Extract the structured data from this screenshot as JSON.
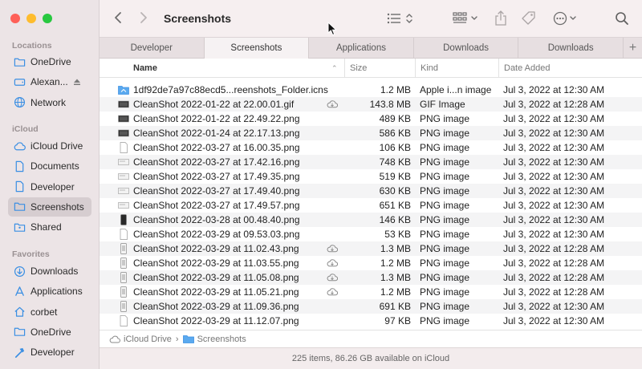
{
  "window": {
    "title": "Screenshots"
  },
  "sidebar": {
    "sections": {
      "locations": "Locations",
      "icloud": "iCloud",
      "favorites": "Favorites"
    },
    "locations": [
      {
        "label": "OneDrive",
        "icon": "folder-icon"
      },
      {
        "label": "Alexan...",
        "icon": "drive-icon"
      },
      {
        "label": "Network",
        "icon": "network-icon"
      }
    ],
    "icloud": [
      {
        "label": "iCloud Drive",
        "icon": "cloud-icon"
      },
      {
        "label": "Documents",
        "icon": "document-icon"
      },
      {
        "label": "Developer",
        "icon": "document-icon"
      },
      {
        "label": "Screenshots",
        "icon": "folder-icon",
        "active": true
      },
      {
        "label": "Shared",
        "icon": "shared-folder-icon"
      }
    ],
    "favorites": [
      {
        "label": "Downloads",
        "icon": "download-icon"
      },
      {
        "label": "Applications",
        "icon": "applications-icon"
      },
      {
        "label": "corbet",
        "icon": "home-icon"
      },
      {
        "label": "OneDrive",
        "icon": "folder-icon"
      },
      {
        "label": "Developer",
        "icon": "hammer-icon"
      }
    ]
  },
  "tabs": [
    {
      "label": "Developer"
    },
    {
      "label": "Screenshots",
      "active": true
    },
    {
      "label": "Applications"
    },
    {
      "label": "Downloads"
    },
    {
      "label": "Downloads"
    }
  ],
  "tab_add_label": "+",
  "columns": {
    "name": "Name",
    "size": "Size",
    "kind": "Kind",
    "date": "Date Added"
  },
  "files": [
    {
      "name": "1df92de7a97c88ecd5...reenshots_Folder.icns",
      "size": "1.2 MB",
      "kind": "Apple i...n image",
      "date": "Jul 3, 2022 at 12:30 AM",
      "cloud": false,
      "icon": "folder"
    },
    {
      "name": "CleanShot 2022-01-22 at 22.00.01.gif",
      "size": "143.8 MB",
      "kind": "GIF Image",
      "date": "Jul 3, 2022 at 12:28 AM",
      "cloud": true,
      "icon": "dark"
    },
    {
      "name": "CleanShot 2022-01-22 at 22.49.22.png",
      "size": "489 KB",
      "kind": "PNG image",
      "date": "Jul 3, 2022 at 12:30 AM",
      "cloud": false,
      "icon": "dark"
    },
    {
      "name": "CleanShot 2022-01-24 at 22.17.13.png",
      "size": "586 KB",
      "kind": "PNG image",
      "date": "Jul 3, 2022 at 12:30 AM",
      "cloud": false,
      "icon": "dark"
    },
    {
      "name": "CleanShot 2022-03-27 at 16.00.35.png",
      "size": "106 KB",
      "kind": "PNG image",
      "date": "Jul 3, 2022 at 12:30 AM",
      "cloud": false,
      "icon": "doc"
    },
    {
      "name": "CleanShot 2022-03-27 at 17.42.16.png",
      "size": "748 KB",
      "kind": "PNG image",
      "date": "Jul 3, 2022 at 12:30 AM",
      "cloud": false,
      "icon": "light"
    },
    {
      "name": "CleanShot 2022-03-27 at 17.49.35.png",
      "size": "519 KB",
      "kind": "PNG image",
      "date": "Jul 3, 2022 at 12:30 AM",
      "cloud": false,
      "icon": "light"
    },
    {
      "name": "CleanShot 2022-03-27 at 17.49.40.png",
      "size": "630 KB",
      "kind": "PNG image",
      "date": "Jul 3, 2022 at 12:30 AM",
      "cloud": false,
      "icon": "light"
    },
    {
      "name": "CleanShot 2022-03-27 at 17.49.57.png",
      "size": "651 KB",
      "kind": "PNG image",
      "date": "Jul 3, 2022 at 12:30 AM",
      "cloud": false,
      "icon": "light"
    },
    {
      "name": "CleanShot 2022-03-28 at 00.48.40.png",
      "size": "146 KB",
      "kind": "PNG image",
      "date": "Jul 3, 2022 at 12:30 AM",
      "cloud": false,
      "icon": "phone"
    },
    {
      "name": "CleanShot 2022-03-29 at 09.53.03.png",
      "size": "53 KB",
      "kind": "PNG image",
      "date": "Jul 3, 2022 at 12:30 AM",
      "cloud": false,
      "icon": "doc"
    },
    {
      "name": "CleanShot 2022-03-29 at 11.02.43.png",
      "size": "1.3 MB",
      "kind": "PNG image",
      "date": "Jul 3, 2022 at 12:28 AM",
      "cloud": true,
      "icon": "phone-light"
    },
    {
      "name": "CleanShot 2022-03-29 at 11.03.55.png",
      "size": "1.2 MB",
      "kind": "PNG image",
      "date": "Jul 3, 2022 at 12:28 AM",
      "cloud": true,
      "icon": "phone-light"
    },
    {
      "name": "CleanShot 2022-03-29 at 11.05.08.png",
      "size": "1.3 MB",
      "kind": "PNG image",
      "date": "Jul 3, 2022 at 12:28 AM",
      "cloud": true,
      "icon": "phone-light"
    },
    {
      "name": "CleanShot 2022-03-29 at 11.05.21.png",
      "size": "1.2 MB",
      "kind": "PNG image",
      "date": "Jul 3, 2022 at 12:28 AM",
      "cloud": true,
      "icon": "phone-light"
    },
    {
      "name": "CleanShot 2022-03-29 at 11.09.36.png",
      "size": "691 KB",
      "kind": "PNG image",
      "date": "Jul 3, 2022 at 12:30 AM",
      "cloud": false,
      "icon": "phone-light"
    },
    {
      "name": "CleanShot 2022-03-29 at 11.12.07.png",
      "size": "97 KB",
      "kind": "PNG image",
      "date": "Jul 3, 2022 at 12:30 AM",
      "cloud": false,
      "icon": "doc"
    }
  ],
  "pathbar": {
    "root": "iCloud Drive",
    "separator": "›",
    "current": "Screenshots"
  },
  "status": "225 items, 86.26 GB available on iCloud",
  "colors": {
    "sidebar_bg": "#ece4e6",
    "accent_blue": "#3b8fe3",
    "row_alt": "#f4f4f5"
  }
}
